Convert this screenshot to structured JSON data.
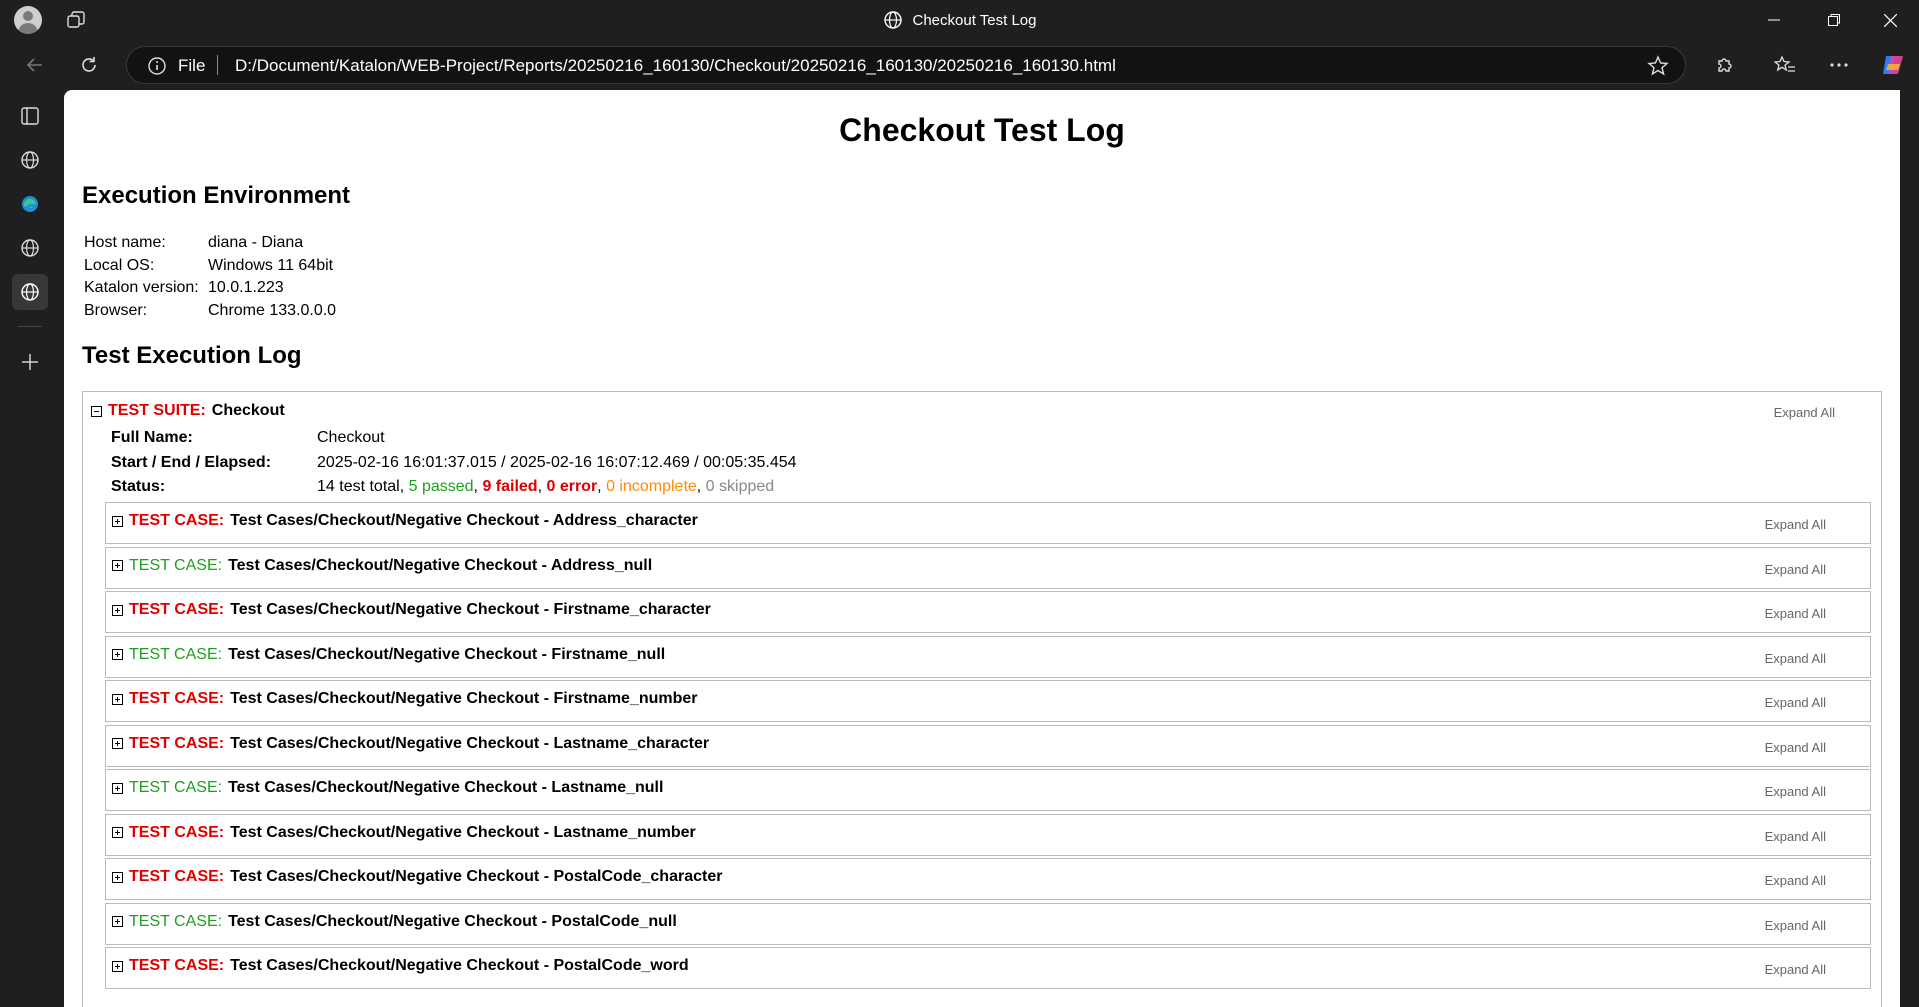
{
  "window": {
    "title": "Checkout Test Log"
  },
  "address_bar": {
    "scheme_label": "File",
    "url": "D:/Document/Katalon/WEB-Project/Reports/20250216_160130/Checkout/20250216_160130/20250216_160130.html"
  },
  "page": {
    "title": "Checkout Test Log",
    "env_heading": "Execution Environment",
    "environment": [
      {
        "key": "Host name:",
        "value": "diana - Diana"
      },
      {
        "key": "Local OS:",
        "value": "Windows 11 64bit"
      },
      {
        "key": "Katalon version:",
        "value": "10.0.1.223"
      },
      {
        "key": "Browser:",
        "value": "Chrome 133.0.0.0"
      }
    ],
    "log_heading": "Test Execution Log",
    "suite": {
      "prefix": "TEST SUITE:",
      "name": "Checkout",
      "expand_all": "Expand All",
      "full_name_label": "Full Name:",
      "full_name": "Checkout",
      "timing_label": "Start / End / Elapsed:",
      "timing": "2025-02-16 16:01:37.015 / 2025-02-16 16:07:12.469 / 00:05:35.454",
      "status_label": "Status:",
      "status": {
        "total": "14 test total",
        "passed": "5 passed",
        "failed": "9 failed",
        "error": "0 error",
        "incomplete": "0 incomplete",
        "skipped": "0 skipped"
      }
    },
    "case_prefix": "TEST CASE:",
    "cases": [
      {
        "name": "Test Cases/Checkout/Negative Checkout - Address_character",
        "status": "failed",
        "expand_all": "Expand All"
      },
      {
        "name": "Test Cases/Checkout/Negative Checkout - Address_null",
        "status": "passed",
        "expand_all": "Expand All"
      },
      {
        "name": "Test Cases/Checkout/Negative Checkout - Firstname_character",
        "status": "failed",
        "expand_all": "Expand All"
      },
      {
        "name": "Test Cases/Checkout/Negative Checkout - Firstname_null",
        "status": "passed",
        "expand_all": "Expand All"
      },
      {
        "name": "Test Cases/Checkout/Negative Checkout - Firstname_number",
        "status": "failed",
        "expand_all": "Expand All"
      },
      {
        "name": "Test Cases/Checkout/Negative Checkout - Lastname_character",
        "status": "failed",
        "expand_all": "Expand All"
      },
      {
        "name": "Test Cases/Checkout/Negative Checkout - Lastname_null",
        "status": "passed",
        "expand_all": "Expand All"
      },
      {
        "name": "Test Cases/Checkout/Negative Checkout - Lastname_number",
        "status": "failed",
        "expand_all": "Expand All"
      },
      {
        "name": "Test Cases/Checkout/Negative Checkout - PostalCode_character",
        "status": "failed",
        "expand_all": "Expand All"
      },
      {
        "name": "Test Cases/Checkout/Negative Checkout - PostalCode_null",
        "status": "passed",
        "expand_all": "Expand All"
      },
      {
        "name": "Test Cases/Checkout/Negative Checkout - PostalCode_word",
        "status": "failed",
        "expand_all": "Expand All"
      }
    ]
  },
  "colors": {
    "failed": "#e00000",
    "passed": "#1e9f1e",
    "incomplete": "#ff8c00",
    "skipped": "#888888"
  }
}
